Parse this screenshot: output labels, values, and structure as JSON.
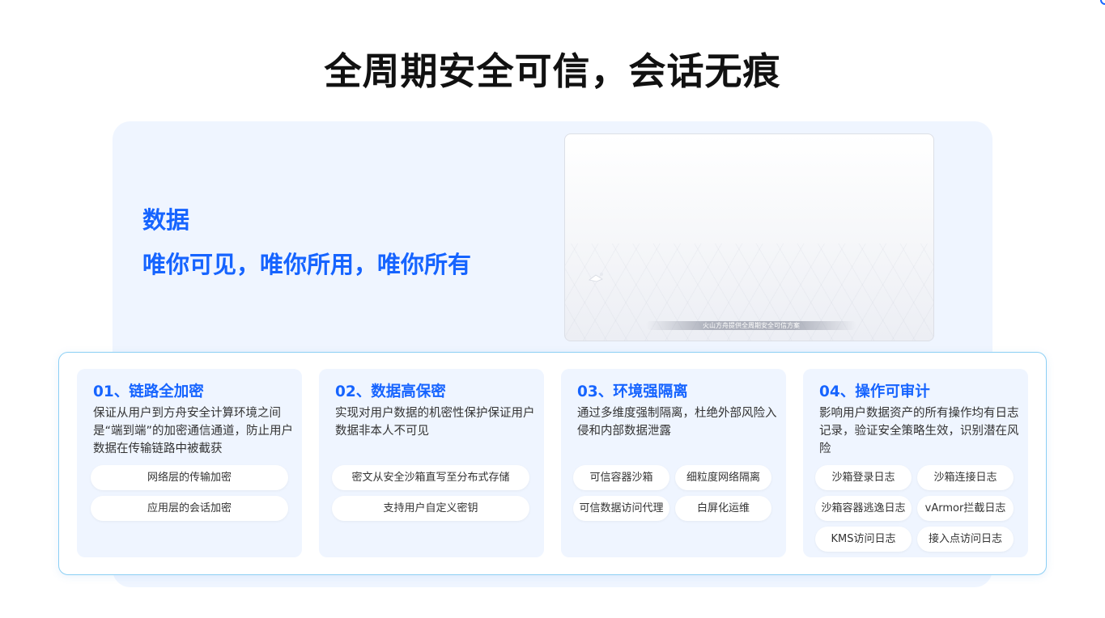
{
  "page": {
    "title": "全周期安全可信，会话无痕"
  },
  "hero": {
    "heading_line1": "数据",
    "heading_line2": "唯你可见，唯你所用，唯你所有",
    "video_caption": "火山方舟提供全周期安全可信方案"
  },
  "cards": [
    {
      "title": "01、链路全加密",
      "description": "保证从用户到方舟安全计算环境之间是“端到端”的加密通信通道，防止用户数据在传输链路中被截获",
      "tags": [
        "网络层的传输加密",
        "应用层的会话加密"
      ]
    },
    {
      "title": "02、数据高保密",
      "description": "实现对用户数据的机密性保护保证用户数据非本人不可见",
      "tags": [
        "密文从安全沙箱直写至分布式存储",
        "支持用户自定义密钥"
      ]
    },
    {
      "title": "03、环境强隔离",
      "description": "通过多维度强制隔离，杜绝外部风险入侵和内部数据泄露",
      "tags": [
        "可信容器沙箱",
        "细粒度网络隔离",
        "可信数据访问代理",
        "白屏化运维"
      ]
    },
    {
      "title": "04、操作可审计",
      "description": "影响用户数据资产的所有操作均有日志记录，验证安全策略生效，识别潜在风险",
      "tags": [
        "沙箱登录日志",
        "沙箱连接日志",
        "沙箱容器逃逸日志",
        "vArmor拦截日志",
        "KMS访问日志",
        "接入点访问日志"
      ]
    }
  ],
  "colors": {
    "accent": "#1664ff",
    "hero_bg": "#eff5ff",
    "panel_border": "#8ccff4",
    "text": "#333333",
    "title": "#111111"
  }
}
